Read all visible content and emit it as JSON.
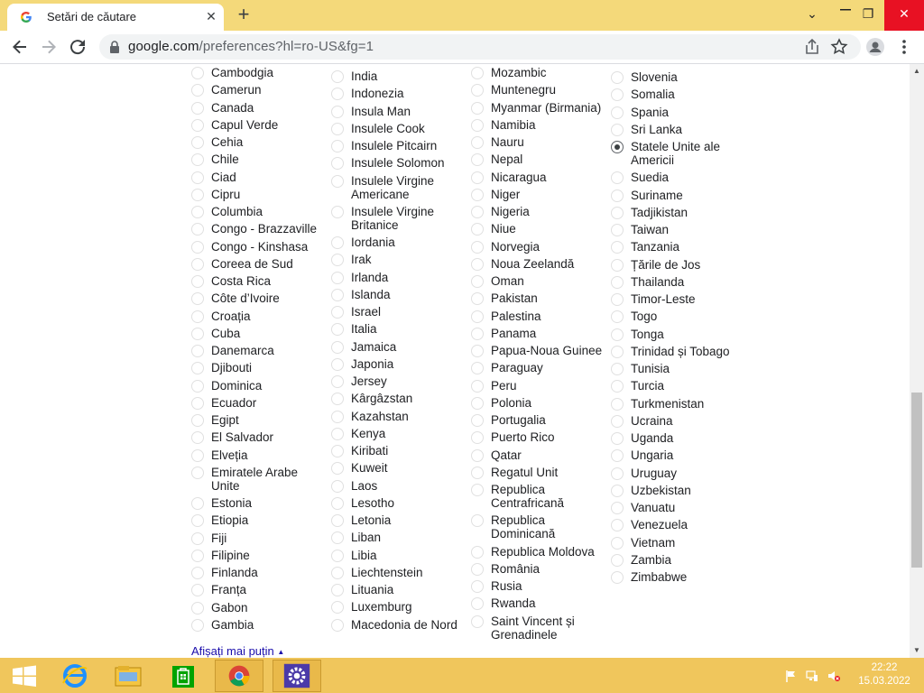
{
  "browser": {
    "tab_title": "Setări de căutare",
    "tab_close": "✕",
    "new_tab": "+",
    "url_host": "google.com",
    "url_rest": "/preferences?hl=ro-US&fg=1"
  },
  "window": {
    "minimize": "⌄",
    "restore": "❐",
    "close": "✕"
  },
  "columns": [
    [
      "Cambodgia",
      "Camerun",
      "Canada",
      "Capul Verde",
      "Cehia",
      "Chile",
      "Ciad",
      "Cipru",
      "Columbia",
      "Congo - Brazzaville",
      "Congo - Kinshasa",
      "Coreea de Sud",
      "Costa Rica",
      "Côte d’Ivoire",
      "Croația",
      "Cuba",
      "Danemarca",
      "Djibouti",
      "Dominica",
      "Ecuador",
      "Egipt",
      "El Salvador",
      "Elveția",
      "Emiratele Arabe\nUnite",
      "Estonia",
      "Etiopia",
      "Fiji",
      "Filipine",
      "Finlanda",
      "Franța",
      "Gabon",
      "Gambia"
    ],
    [
      "India",
      "Indonezia",
      "Insula Man",
      "Insulele Cook",
      "Insulele Pitcairn",
      "Insulele Solomon",
      "Insulele Virgine\nAmericane",
      "Insulele Virgine\nBritanice",
      "Iordania",
      "Irak",
      "Irlanda",
      "Islanda",
      "Israel",
      "Italia",
      "Jamaica",
      "Japonia",
      "Jersey",
      "Kârgâzstan",
      "Kazahstan",
      "Kenya",
      "Kiribati",
      "Kuweit",
      "Laos",
      "Lesotho",
      "Letonia",
      "Liban",
      "Libia",
      "Liechtenstein",
      "Lituania",
      "Luxemburg",
      "Macedonia de Nord"
    ],
    [
      "Mozambic",
      "Muntenegru",
      "Myanmar (Birmania)",
      "Namibia",
      "Nauru",
      "Nepal",
      "Nicaragua",
      "Niger",
      "Nigeria",
      "Niue",
      "Norvegia",
      "Noua Zeelandă",
      "Oman",
      "Pakistan",
      "Palestina",
      "Panama",
      "Papua-Noua Guinee",
      "Paraguay",
      "Peru",
      "Polonia",
      "Portugalia",
      "Puerto Rico",
      "Qatar",
      "Regatul Unit",
      "Republica\nCentrafricană",
      "Republica\nDominicană",
      "Republica Moldova",
      "România",
      "Rusia",
      "Rwanda",
      "Saint Vincent și\nGrenadinele"
    ],
    [
      "Slovenia",
      "Somalia",
      "Spania",
      "Sri Lanka",
      "Statele Unite ale\nAmericii",
      "Suedia",
      "Suriname",
      "Tadjikistan",
      "Taiwan",
      "Tanzania",
      "Țările de Jos",
      "Thailanda",
      "Timor-Leste",
      "Togo",
      "Tonga",
      "Trinidad și Tobago",
      "Tunisia",
      "Turcia",
      "Turkmenistan",
      "Ucraina",
      "Uganda",
      "Ungaria",
      "Uruguay",
      "Uzbekistan",
      "Vanuatu",
      "Venezuela",
      "Vietnam",
      "Zambia",
      "Zimbabwe"
    ]
  ],
  "selected_region": "Statele Unite ale\nAmericii",
  "show_less_link": "Afișați mai puțin",
  "clock": {
    "time": "22:22",
    "date": "15.03.2022"
  }
}
